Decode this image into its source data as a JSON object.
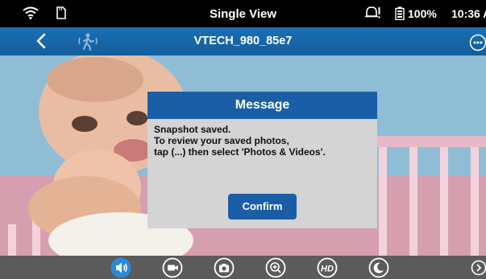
{
  "status_bar": {
    "title": "Single View",
    "battery": "100%",
    "time": "10:36 A"
  },
  "nav_bar": {
    "camera_name": "VTECH_980_85e7"
  },
  "dialog": {
    "title": "Message",
    "lines": [
      "Snapshot saved.",
      "To review your saved photos,",
      "tap (...) then select 'Photos & Videos'."
    ],
    "confirm_label": "Confirm"
  },
  "toolbar": {
    "hd_label": "HD",
    "items": [
      "speaker-icon",
      "video-record-icon",
      "camera-snapshot-icon",
      "zoom-in-icon",
      "hd-icon",
      "night-mode-icon",
      "next-arrow-icon"
    ]
  },
  "colors": {
    "nav_blue": "#1a6fb5",
    "dialog_header": "#1a5fa6",
    "dialog_bg": "#d4d4d4",
    "toolbar_bg": "#5b5b5b",
    "speaker_active": "#2a8ad8"
  }
}
